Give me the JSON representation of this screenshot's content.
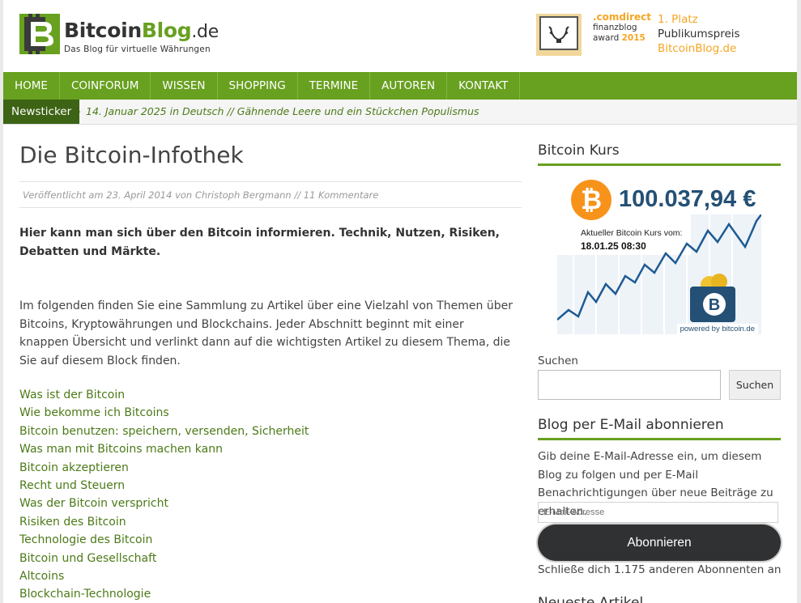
{
  "header": {
    "logo_name": "Bitcoin",
    "logo_blog": "Blog",
    "logo_tld": ".de",
    "tagline": "Das Blog für virtuelle Währungen",
    "award_brand_prefix": ".com",
    "award_brand_suffix": "direct",
    "award_line1": "finanzblog",
    "award_line2": "award",
    "award_year": "2015",
    "award_place": "1. Platz",
    "award_prize": "Publikumspreis",
    "award_site": "BitcoinBlog.de"
  },
  "nav": {
    "items": [
      "HOME",
      "COINFORUM",
      "WISSEN",
      "SHOPPING",
      "TERMINE",
      "AUTOREN",
      "KONTAKT"
    ]
  },
  "ticker": {
    "label": "Newsticker",
    "text": "14. Januar 2025 in Deutsch // Gähnende Leere und ein Stückchen Populismus"
  },
  "article": {
    "title": "Die Bitcoin-Infothek",
    "meta": "Veröffentlicht am 23. April 2014 von Christoph Bergmann // 11 Kommentare",
    "lead": "Hier kann man sich über den Bitcoin informieren. Technik, Nutzen, Risiken, Debatten und Märkte.",
    "intro": "Im folgenden finden Sie eine Sammlung zu Artikel über eine Vielzahl von Themen über Bitcoins, Kryptowährungen und Blockchains. Jeder Abschnitt beginnt mit einer knappen Übersicht und verlinkt dann auf die wichtigsten Artikel zu diesem Thema, die Sie auf diesem Block finden.",
    "links": [
      "Was ist der Bitcoin",
      "Wie bekomme ich Bitcoins",
      "Bitcoin benutzen: speichern, versenden, Sicherheit",
      "Was man mit Bitcoins machen kann",
      "Bitcoin akzeptieren",
      "Recht und Steuern",
      "Was der Bitcoin verspricht",
      "Risiken des Bitcoin",
      "Technologie des Bitcoin",
      "Bitcoin und Gesellschaft",
      "Altcoins",
      "Blockchain-Technologie"
    ]
  },
  "sidebar": {
    "kurs_title": "Bitcoin Kurs",
    "kurs_price": "100.037,94 €",
    "kurs_label": "Aktueller Bitcoin Kurs vom:",
    "kurs_date": "18.01.25 08:30",
    "kurs_powered": "powered by bitcoin.de",
    "coin_symbol": "₿",
    "search_label": "Suchen",
    "search_button": "Suchen",
    "mail_title": "Blog per E-Mail abonnieren",
    "mail_text": "Gib deine E-Mail-Adresse ein, um diesem Blog zu folgen und per E-Mail Benachrichtigungen über neue Beiträge zu erhalten.",
    "mail_placeholder": "E-Mail-Adresse",
    "mail_button": "Abonnieren",
    "mail_count": "Schließe dich 1.175 anderen Abonnenten an",
    "next_title": "Neueste Artikel"
  },
  "colors": {
    "brand_green": "#68a020",
    "dark_green": "#3d6314",
    "link_green": "#4c7a18",
    "bitcoin_orange": "#f7931a",
    "price_blue": "#245075",
    "award_gold": "#f5a623"
  }
}
